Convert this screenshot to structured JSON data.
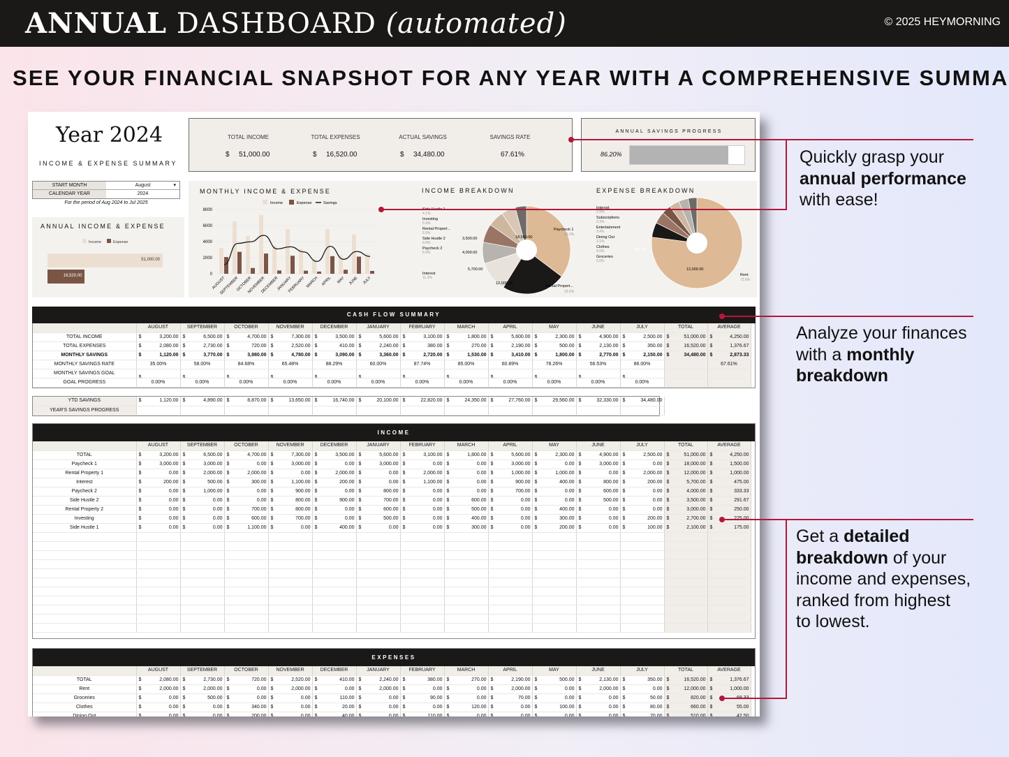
{
  "header": {
    "title_bold": "ANNUAL",
    "title_normal": "DASHBOARD",
    "title_italic": "(automated)",
    "copyright": "© 2025 HEYMORNING"
  },
  "subtitle": "SEE YOUR FINANCIAL SNAPSHOT FOR ANY YEAR WITH A COMPREHENSIVE SUMMARY",
  "sheet": {
    "year_title": "Year 2024",
    "summary_label": "INCOME & EXPENSE SUMMARY",
    "controls": {
      "start_month_label": "START MONTH",
      "start_month_value": "August",
      "calendar_year_label": "CALENDAR YEAR",
      "calendar_year_value": "2024",
      "period_note": "For the period of Aug 2024 to Jul 2025"
    },
    "kpis": [
      {
        "label": "TOTAL INCOME",
        "cur": "$",
        "value": "51,000.00"
      },
      {
        "label": "TOTAL EXPENSES",
        "cur": "$",
        "value": "16,520.00"
      },
      {
        "label": "ACTUAL SAVINGS",
        "cur": "$",
        "value": "34,480.00"
      },
      {
        "label": "SAVINGS RATE",
        "cur": "",
        "value": "67.61%"
      }
    ],
    "savings_progress": {
      "label": "ANNUAL SAVINGS PROGRESS",
      "value": "86.20%",
      "fraction": 0.862
    },
    "annual_ie": {
      "title": "ANNUAL INCOME & EXPENSE",
      "legend_income": "Income",
      "legend_expense": "Expense",
      "income_label": "51,000.00",
      "expense_label": "16,520.00",
      "income": 51000,
      "expense": 16520
    },
    "monthly_chart": {
      "title": "MONTHLY INCOME & EXPENSE",
      "legend": [
        "Income",
        "Expense",
        "Savings"
      ],
      "y_ticks": [
        "8000",
        "6000",
        "4000",
        "2000",
        "0"
      ]
    },
    "income_breakdown": {
      "title": "INCOME BREAKDOWN",
      "labels": [
        {
          "name": "Side Hustle 1",
          "pct": "4.1%"
        },
        {
          "name": "Investing",
          "pct": "5.3%"
        },
        {
          "name": "Rental Propert...",
          "pct": "5.9%"
        },
        {
          "name": "Side Hustle 2",
          "pct": "6.9%"
        },
        {
          "name": "Paycheck 2",
          "pct": "6.9%"
        },
        {
          "name": "Interest",
          "pct": "11.2%"
        },
        {
          "name": "Paycheck 1",
          "pct": "35.3%"
        },
        {
          "name": "Rental Propert...",
          "pct": "23.5%"
        }
      ],
      "slice_labels": [
        "18,000.00",
        "12,000.00",
        "5,700.00",
        "4,000.00",
        "3,500.00"
      ]
    },
    "expense_breakdown": {
      "title": "EXPENSE BREAKDOWN",
      "labels": [
        {
          "name": "Internet",
          "pct": "2.9%"
        },
        {
          "name": "Subscriptions",
          "pct": "3.3%"
        },
        {
          "name": "Entertainment",
          "pct": "3.4%"
        },
        {
          "name": "Dining Out",
          "pct": "3.1%"
        },
        {
          "name": "Clothes",
          "pct": "4.0%"
        },
        {
          "name": "Groceries",
          "pct": "5.0%"
        },
        {
          "name": "Rent",
          "pct": "72.6%"
        }
      ],
      "slice_labels": [
        "12,000.00",
        "820.00"
      ]
    }
  },
  "chart_data": [
    {
      "type": "bar",
      "title": "MONTHLY INCOME & EXPENSE",
      "categories": [
        "AUGUST",
        "SEPTEMBER",
        "OCTOBER",
        "NOVEMBER",
        "DECEMBER",
        "JANUARY",
        "FEBRUARY",
        "MARCH",
        "APRIL",
        "MAY",
        "JUNE",
        "JULY"
      ],
      "series": [
        {
          "name": "Income",
          "values": [
            3200,
            6500,
            4700,
            7300,
            3500,
            5600,
            3100,
            1800,
            5600,
            2300,
            4900,
            2500
          ]
        },
        {
          "name": "Expense",
          "values": [
            2080,
            2730,
            720,
            2520,
            410,
            2240,
            380,
            270,
            2190,
            500,
            2130,
            350
          ]
        },
        {
          "name": "Savings",
          "values": [
            1120,
            3770,
            3980,
            4780,
            3090,
            3360,
            2720,
            1530,
            3410,
            1800,
            2770,
            2150
          ]
        }
      ],
      "ylim": [
        0,
        8000
      ]
    },
    {
      "type": "pie",
      "title": "INCOME BREAKDOWN",
      "categories": [
        "Paycheck 1",
        "Rental Property 1",
        "Interest",
        "Paycheck 2",
        "Side Hustle 2",
        "Rental Property 2",
        "Investing",
        "Side Hustle 1"
      ],
      "values": [
        18000,
        12000,
        5700,
        4000,
        3500,
        3000,
        2700,
        2100
      ]
    },
    {
      "type": "pie",
      "title": "EXPENSE BREAKDOWN",
      "categories": [
        "Rent",
        "Groceries",
        "Clothes",
        "Dining Out",
        "Entertainment",
        "Subscriptions",
        "Internet"
      ],
      "values": [
        12000,
        820,
        660,
        510,
        560,
        540,
        480
      ]
    },
    {
      "type": "bar",
      "title": "ANNUAL INCOME & EXPENSE",
      "categories": [
        "Income",
        "Expense"
      ],
      "values": [
        51000,
        16520
      ]
    }
  ],
  "months": [
    "AUGUST",
    "SEPTEMBER",
    "OCTOBER",
    "NOVEMBER",
    "DECEMBER",
    "JANUARY",
    "FEBRUARY",
    "MARCH",
    "APRIL",
    "MAY",
    "JUNE",
    "JULY",
    "TOTAL",
    "AVERAGE"
  ],
  "cashflow": {
    "title": "CASH FLOW SUMMARY",
    "rows": [
      {
        "label": "TOTAL INCOME",
        "vals": [
          "3,200.00",
          "6,500.00",
          "4,700.00",
          "7,300.00",
          "3,500.00",
          "5,600.00",
          "3,100.00",
          "1,800.00",
          "5,600.00",
          "2,300.00",
          "4,900.00",
          "2,500.00",
          "51,000.00",
          "4,250.00"
        ]
      },
      {
        "label": "TOTAL EXPENSES",
        "vals": [
          "2,080.00",
          "2,730.00",
          "720.00",
          "2,520.00",
          "410.00",
          "2,240.00",
          "380.00",
          "270.00",
          "2,190.00",
          "500.00",
          "2,130.00",
          "350.00",
          "16,520.00",
          "1,376.67"
        ]
      },
      {
        "label": "MONTHLY SAVINGS",
        "vals": [
          "1,120.00",
          "3,770.00",
          "3,980.00",
          "4,780.00",
          "3,090.00",
          "3,360.00",
          "2,720.00",
          "1,530.00",
          "3,410.00",
          "1,800.00",
          "2,770.00",
          "2,150.00",
          "34,480.00",
          "2,873.33"
        ]
      },
      {
        "label": "MONTHLY SAVINGS RATE",
        "vals": [
          "35.00%",
          "58.00%",
          "84.68%",
          "65.48%",
          "88.29%",
          "60.00%",
          "87.74%",
          "85.00%",
          "60.89%",
          "78.26%",
          "56.53%",
          "86.00%",
          "",
          "67.61%"
        ]
      },
      {
        "label": "MONTHLY SAVINGS GOAL",
        "vals": [
          "",
          "",
          "",
          "",
          "",
          "",
          "",
          "",
          "",
          "",
          "",
          "",
          "",
          ""
        ]
      },
      {
        "label": "GOAL PROGRESS",
        "vals": [
          "0.00%",
          "0.00%",
          "0.00%",
          "0.00%",
          "0.00%",
          "0.00%",
          "0.00%",
          "0.00%",
          "0.00%",
          "0.00%",
          "0.00%",
          "0.00%",
          "",
          ""
        ]
      }
    ]
  },
  "ytd": {
    "rows": [
      {
        "label": "YTD SAVINGS",
        "vals": [
          "1,120.00",
          "4,890.00",
          "8,870.00",
          "13,650.00",
          "16,740.00",
          "20,100.00",
          "22,820.00",
          "24,350.00",
          "27,760.00",
          "29,560.00",
          "32,330.00",
          "34,480.00"
        ]
      },
      {
        "label": "YEAR'S SAVINGS PROGRESS",
        "vals": [
          "",
          "",
          "",
          "",
          "",
          "",
          "",
          "",
          "",
          "",
          "",
          ""
        ]
      }
    ]
  },
  "income": {
    "title": "INCOME",
    "rows": [
      {
        "label": "TOTAL",
        "vals": [
          "3,200.00",
          "6,500.00",
          "4,700.00",
          "7,300.00",
          "3,500.00",
          "5,600.00",
          "3,100.00",
          "1,800.00",
          "5,600.00",
          "2,300.00",
          "4,900.00",
          "2,500.00",
          "51,000.00",
          "4,250.00"
        ]
      },
      {
        "label": "Paycheck 1",
        "vals": [
          "3,000.00",
          "3,000.00",
          "0.00",
          "3,000.00",
          "0.00",
          "3,000.00",
          "0.00",
          "0.00",
          "3,000.00",
          "0.00",
          "3,000.00",
          "0.00",
          "18,000.00",
          "1,500.00"
        ]
      },
      {
        "label": "Rental Property 1",
        "vals": [
          "0.00",
          "2,000.00",
          "2,000.00",
          "0.00",
          "2,000.00",
          "0.00",
          "2,000.00",
          "0.00",
          "1,000.00",
          "1,000.00",
          "0.00",
          "2,000.00",
          "12,000.00",
          "1,000.00"
        ]
      },
      {
        "label": "Interest",
        "vals": [
          "200.00",
          "500.00",
          "300.00",
          "1,100.00",
          "200.00",
          "0.00",
          "1,100.00",
          "0.00",
          "900.00",
          "400.00",
          "800.00",
          "200.00",
          "5,700.00",
          "475.00"
        ]
      },
      {
        "label": "Paycheck 2",
        "vals": [
          "0.00",
          "1,000.00",
          "0.00",
          "900.00",
          "0.00",
          "800.00",
          "0.00",
          "0.00",
          "700.00",
          "0.00",
          "600.00",
          "0.00",
          "4,000.00",
          "333.33"
        ]
      },
      {
        "label": "Side Hustle 2",
        "vals": [
          "0.00",
          "0.00",
          "0.00",
          "800.00",
          "900.00",
          "700.00",
          "0.00",
          "600.00",
          "0.00",
          "0.00",
          "500.00",
          "0.00",
          "3,500.00",
          "291.67"
        ]
      },
      {
        "label": "Rental Property 2",
        "vals": [
          "0.00",
          "0.00",
          "700.00",
          "800.00",
          "0.00",
          "600.00",
          "0.00",
          "500.00",
          "0.00",
          "400.00",
          "0.00",
          "0.00",
          "3,000.00",
          "250.00"
        ]
      },
      {
        "label": "Investing",
        "vals": [
          "0.00",
          "0.00",
          "600.00",
          "700.00",
          "0.00",
          "500.00",
          "0.00",
          "400.00",
          "0.00",
          "300.00",
          "0.00",
          "200.00",
          "2,700.00",
          "225.00"
        ]
      },
      {
        "label": "Side Hustle 1",
        "vals": [
          "0.00",
          "0.00",
          "1,100.00",
          "0.00",
          "400.00",
          "0.00",
          "0.00",
          "300.00",
          "0.00",
          "200.00",
          "0.00",
          "100.00",
          "2,100.00",
          "175.00"
        ]
      }
    ]
  },
  "expenses": {
    "title": "EXPENSES",
    "rows": [
      {
        "label": "TOTAL",
        "vals": [
          "2,080.00",
          "2,730.00",
          "720.00",
          "2,520.00",
          "410.00",
          "2,240.00",
          "380.00",
          "270.00",
          "2,190.00",
          "500.00",
          "2,130.00",
          "350.00",
          "16,520.00",
          "1,376.67"
        ]
      },
      {
        "label": "Rent",
        "vals": [
          "2,000.00",
          "2,000.00",
          "0.00",
          "2,000.00",
          "0.00",
          "2,000.00",
          "0.00",
          "0.00",
          "2,000.00",
          "0.00",
          "2,000.00",
          "0.00",
          "12,000.00",
          "1,000.00"
        ]
      },
      {
        "label": "Groceries",
        "vals": [
          "0.00",
          "500.00",
          "0.00",
          "0.00",
          "110.00",
          "0.00",
          "90.00",
          "0.00",
          "70.00",
          "0.00",
          "0.00",
          "50.00",
          "820.00",
          "68.33"
        ]
      },
      {
        "label": "Clothes",
        "vals": [
          "0.00",
          "0.00",
          "340.00",
          "0.00",
          "20.00",
          "0.00",
          "0.00",
          "120.00",
          "0.00",
          "100.00",
          "0.00",
          "80.00",
          "660.00",
          "55.00"
        ]
      },
      {
        "label": "Dining Out",
        "vals": [
          "0.00",
          "0.00",
          "200.00",
          "0.00",
          "40.00",
          "0.00",
          "110.00",
          "0.00",
          "0.00",
          "0.00",
          "0.00",
          "70.00",
          "510.00",
          "42.50"
        ]
      }
    ]
  },
  "annotations": {
    "a1": {
      "t1": "Quickly grasp your",
      "b": "annual performance",
      "t2": "with ease!"
    },
    "a2": {
      "t1": "Analyze your finances",
      "t2": "with a ",
      "b1": "monthly",
      "b2": "breakdown"
    },
    "a3": {
      "t1": "Get a ",
      "b1": "detailed",
      "b2": "breakdown",
      "t2": " of your",
      "t3": "income and expenses,",
      "t4": "ranked from highest",
      "t5": "to lowest."
    }
  },
  "colors": {
    "accent": "#b3173a",
    "dark": "#1b1917",
    "income": "#ecdfd2",
    "expense": "#7a5546",
    "tan": "#ddb995",
    "panel": "#f1eeea"
  }
}
